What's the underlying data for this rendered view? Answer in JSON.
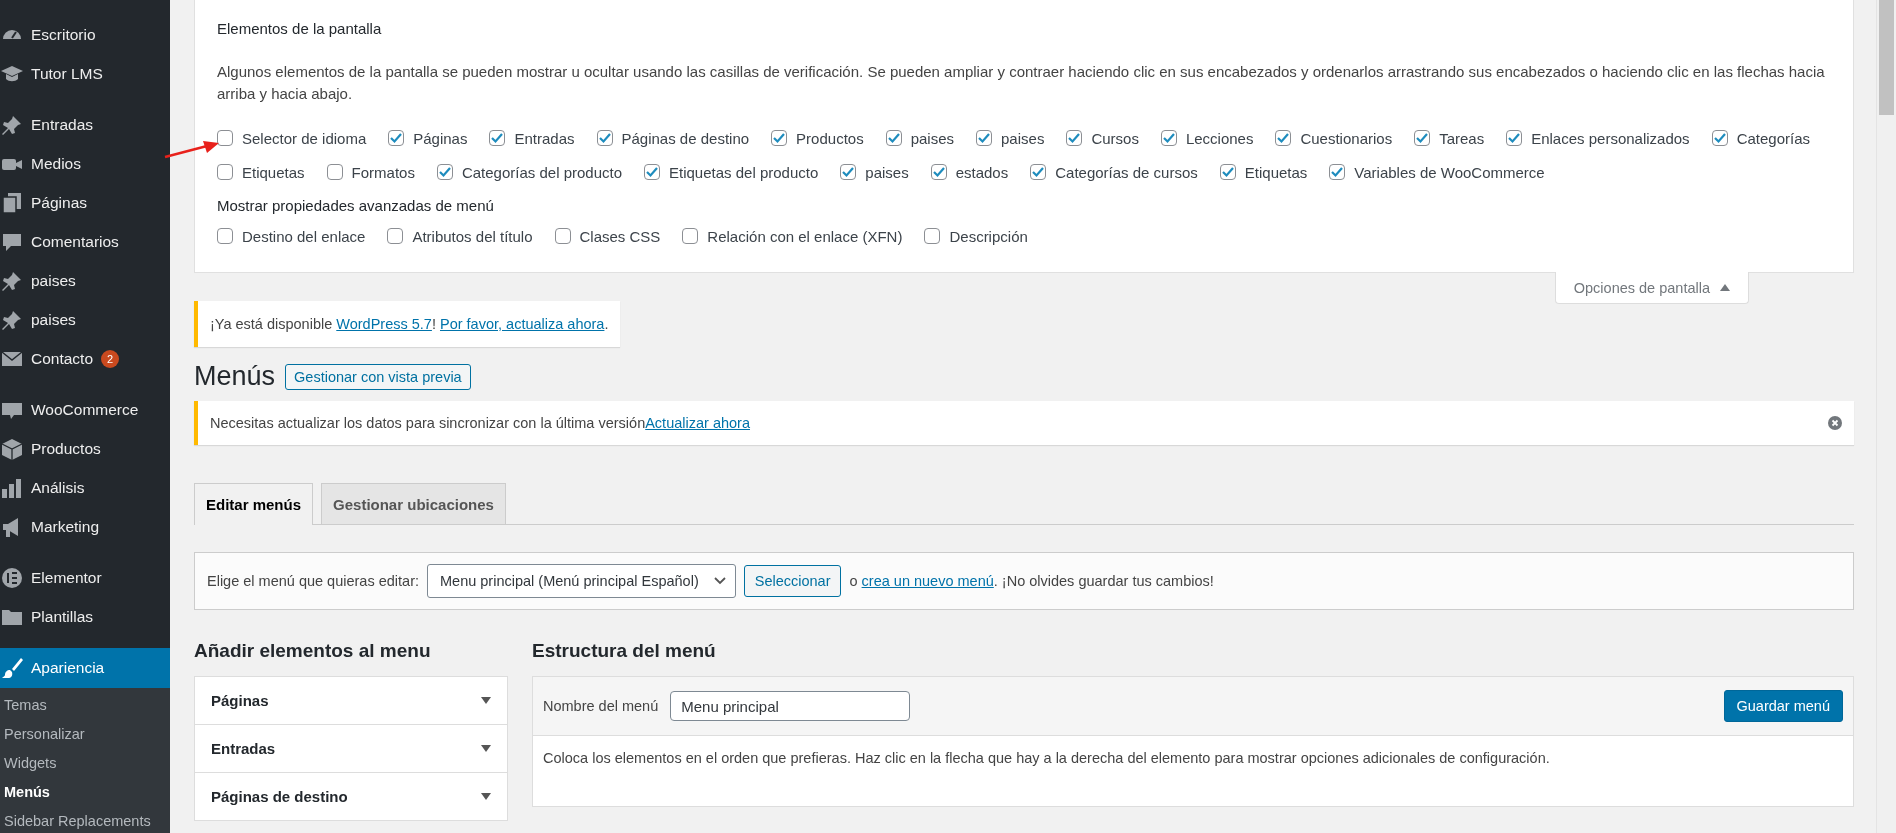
{
  "sidebar": {
    "groups": [
      [
        {
          "label": "Escritorio",
          "selected": false
        },
        {
          "label": "Tutor LMS",
          "selected": false
        }
      ],
      [
        {
          "label": "Entradas",
          "selected": false
        },
        {
          "label": "Medios",
          "selected": false
        },
        {
          "label": "Páginas",
          "selected": false
        },
        {
          "label": "Comentarios",
          "selected": false
        },
        {
          "label": "paises",
          "selected": false
        },
        {
          "label": "paises",
          "selected": false
        },
        {
          "label": "Contacto",
          "selected": false,
          "badge": "2"
        }
      ],
      [
        {
          "label": "WooCommerce",
          "selected": false
        },
        {
          "label": "Productos",
          "selected": false
        },
        {
          "label": "Análisis",
          "selected": false
        },
        {
          "label": "Marketing",
          "selected": false
        }
      ],
      [
        {
          "label": "Elementor",
          "selected": false
        },
        {
          "label": "Plantillas",
          "selected": false
        }
      ],
      [
        {
          "label": "Apariencia",
          "selected": true,
          "children": [
            {
              "label": "Temas",
              "selected": false
            },
            {
              "label": "Personalizar",
              "selected": false
            },
            {
              "label": "Widgets",
              "selected": false
            },
            {
              "label": "Menús",
              "selected": true
            },
            {
              "label": "Sidebar Replacements",
              "selected": false
            }
          ]
        }
      ]
    ]
  },
  "screen_options": {
    "title": "Elementos de la pantalla",
    "description": "Algunos elementos de la pantalla se pueden mostrar u ocultar usando las casillas de verificación. Se pueden ampliar y contraer haciendo clic en sus encabezados y ordenarlos arrastrando sus encabezados o haciendo clic en las flechas hacia arriba y hacia abajo.",
    "boxes": [
      {
        "label": "Selector de idioma",
        "checked": false
      },
      {
        "label": "Páginas",
        "checked": true
      },
      {
        "label": "Entradas",
        "checked": true
      },
      {
        "label": "Páginas de destino",
        "checked": true
      },
      {
        "label": "Productos",
        "checked": true
      },
      {
        "label": "paises",
        "checked": true
      },
      {
        "label": "paises",
        "checked": true
      },
      {
        "label": "Cursos",
        "checked": true
      },
      {
        "label": "Lecciones",
        "checked": true
      },
      {
        "label": "Cuestionarios",
        "checked": true
      },
      {
        "label": "Tareas",
        "checked": true
      },
      {
        "label": "Enlaces personalizados",
        "checked": true
      },
      {
        "label": "Categorías",
        "checked": true
      },
      {
        "label": "Etiquetas",
        "checked": false
      },
      {
        "label": "Formatos",
        "checked": false
      },
      {
        "label": "Categorías del producto",
        "checked": true
      },
      {
        "label": "Etiquetas del producto",
        "checked": true
      },
      {
        "label": "paises",
        "checked": true
      },
      {
        "label": "estados",
        "checked": true
      },
      {
        "label": "Categorías de cursos",
        "checked": true
      },
      {
        "label": "Etiquetas",
        "checked": true
      },
      {
        "label": "Variables de WooCommerce",
        "checked": true
      }
    ],
    "advanced_title": "Mostrar propiedades avanzadas de menú",
    "advanced": [
      {
        "label": "Destino del enlace",
        "checked": false
      },
      {
        "label": "Atributos del título",
        "checked": false
      },
      {
        "label": "Clases CSS",
        "checked": false
      },
      {
        "label": "Relación con el enlace (XFN)",
        "checked": false
      },
      {
        "label": "Descripción",
        "checked": false
      }
    ],
    "toggle": "Opciones de pantalla"
  },
  "update_notice": [
    {
      "kind": "text",
      "text": "¡Ya está disponible "
    },
    {
      "kind": "link",
      "text": "WordPress 5.7"
    },
    {
      "kind": "text",
      "text": "! "
    },
    {
      "kind": "link",
      "text": "Por favor, actualiza ahora"
    },
    {
      "kind": "text",
      "text": "."
    }
  ],
  "page_title": "Menús",
  "preview_button": "Gestionar con vista previa",
  "sync_notice": [
    {
      "kind": "text",
      "text": "Necesitas actualizar los datos para sincronizar con la última versión"
    },
    {
      "kind": "link",
      "text": "Actualizar ahora"
    }
  ],
  "tabs": [
    {
      "label": "Editar menús",
      "selected": true
    },
    {
      "label": "Gestionar ubicaciones",
      "selected": false
    }
  ],
  "menu_select": {
    "label": "Elige el menú que quieras editar:",
    "value": "Menu principal (Menú principal Español)",
    "button": "Seleccionar",
    "after": [
      {
        "kind": "text",
        "text": "o "
      },
      {
        "kind": "link",
        "text": "crea un nuevo menú"
      },
      {
        "kind": "text",
        "text": ". ¡No olvides guardar tus cambios!"
      }
    ]
  },
  "add_items": {
    "title": "Añadir elementos al menu",
    "sections": [
      "Páginas",
      "Entradas",
      "Páginas de destino"
    ]
  },
  "structure": {
    "title": "Estructura del menú",
    "name_label": "Nombre del menú",
    "name_value": "Menu principal",
    "save_button": "Guardar menú",
    "instructions": "Coloca los elementos en el orden que prefieras. Haz clic en la flecha que hay a la derecha del elemento para mostrar opciones adicionales de configuración."
  }
}
